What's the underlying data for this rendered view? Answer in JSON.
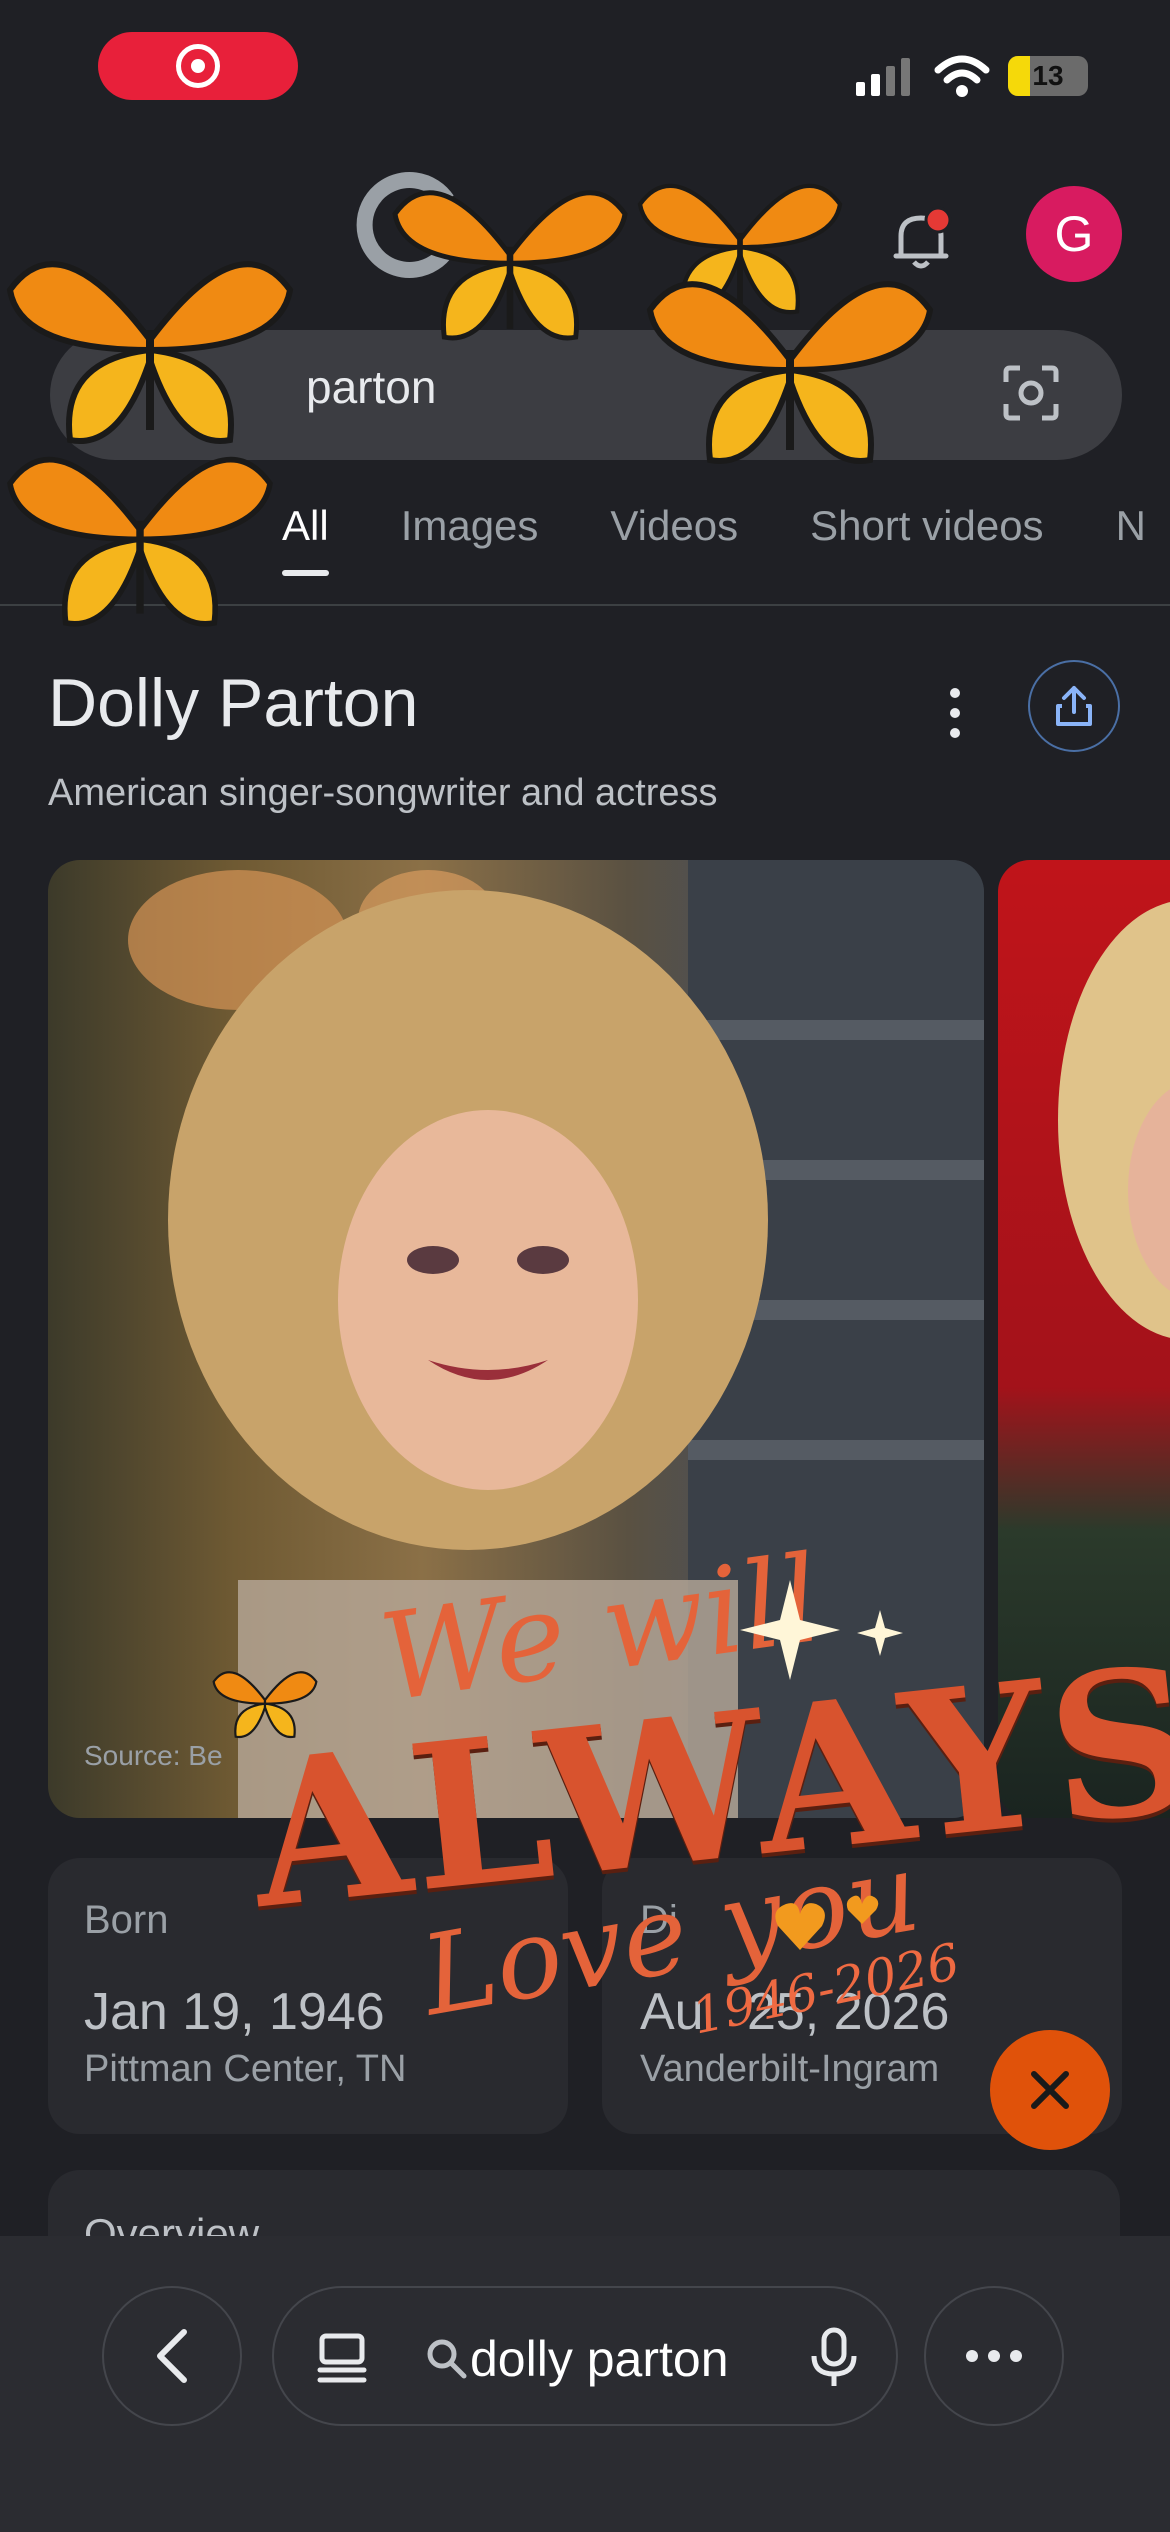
{
  "status_bar": {
    "battery": "13"
  },
  "header": {
    "avatar_letter": "G"
  },
  "search": {
    "query": "dolly parton",
    "query_visible": "parton"
  },
  "tabs": [
    {
      "label": "All",
      "active": true
    },
    {
      "label": "Images"
    },
    {
      "label": "Videos"
    },
    {
      "label": "Short videos"
    },
    {
      "label": "N"
    }
  ],
  "knowledge_panel": {
    "title": "Dolly Parton",
    "subtitle": "American singer-songwriter and actress",
    "image_source": "Source: Be",
    "born": {
      "label": "Born",
      "date": "Jan 19, 1946",
      "place": "Pittman Center, TN"
    },
    "died": {
      "label": "Di",
      "date": "Au   25, 2026",
      "place": "Vanderbilt-Ingram"
    },
    "overview_label": "Overview"
  },
  "overlay": {
    "line1": "We will",
    "line2": "ALWAYS",
    "line3": "Love you",
    "years": "1946-2026"
  },
  "bottom_bar": {
    "search_text": "dolly parton"
  },
  "colors": {
    "accent": "#d81b60",
    "fab": "#e0520a",
    "record": "#e8203a",
    "overlay": "#e4633a"
  }
}
